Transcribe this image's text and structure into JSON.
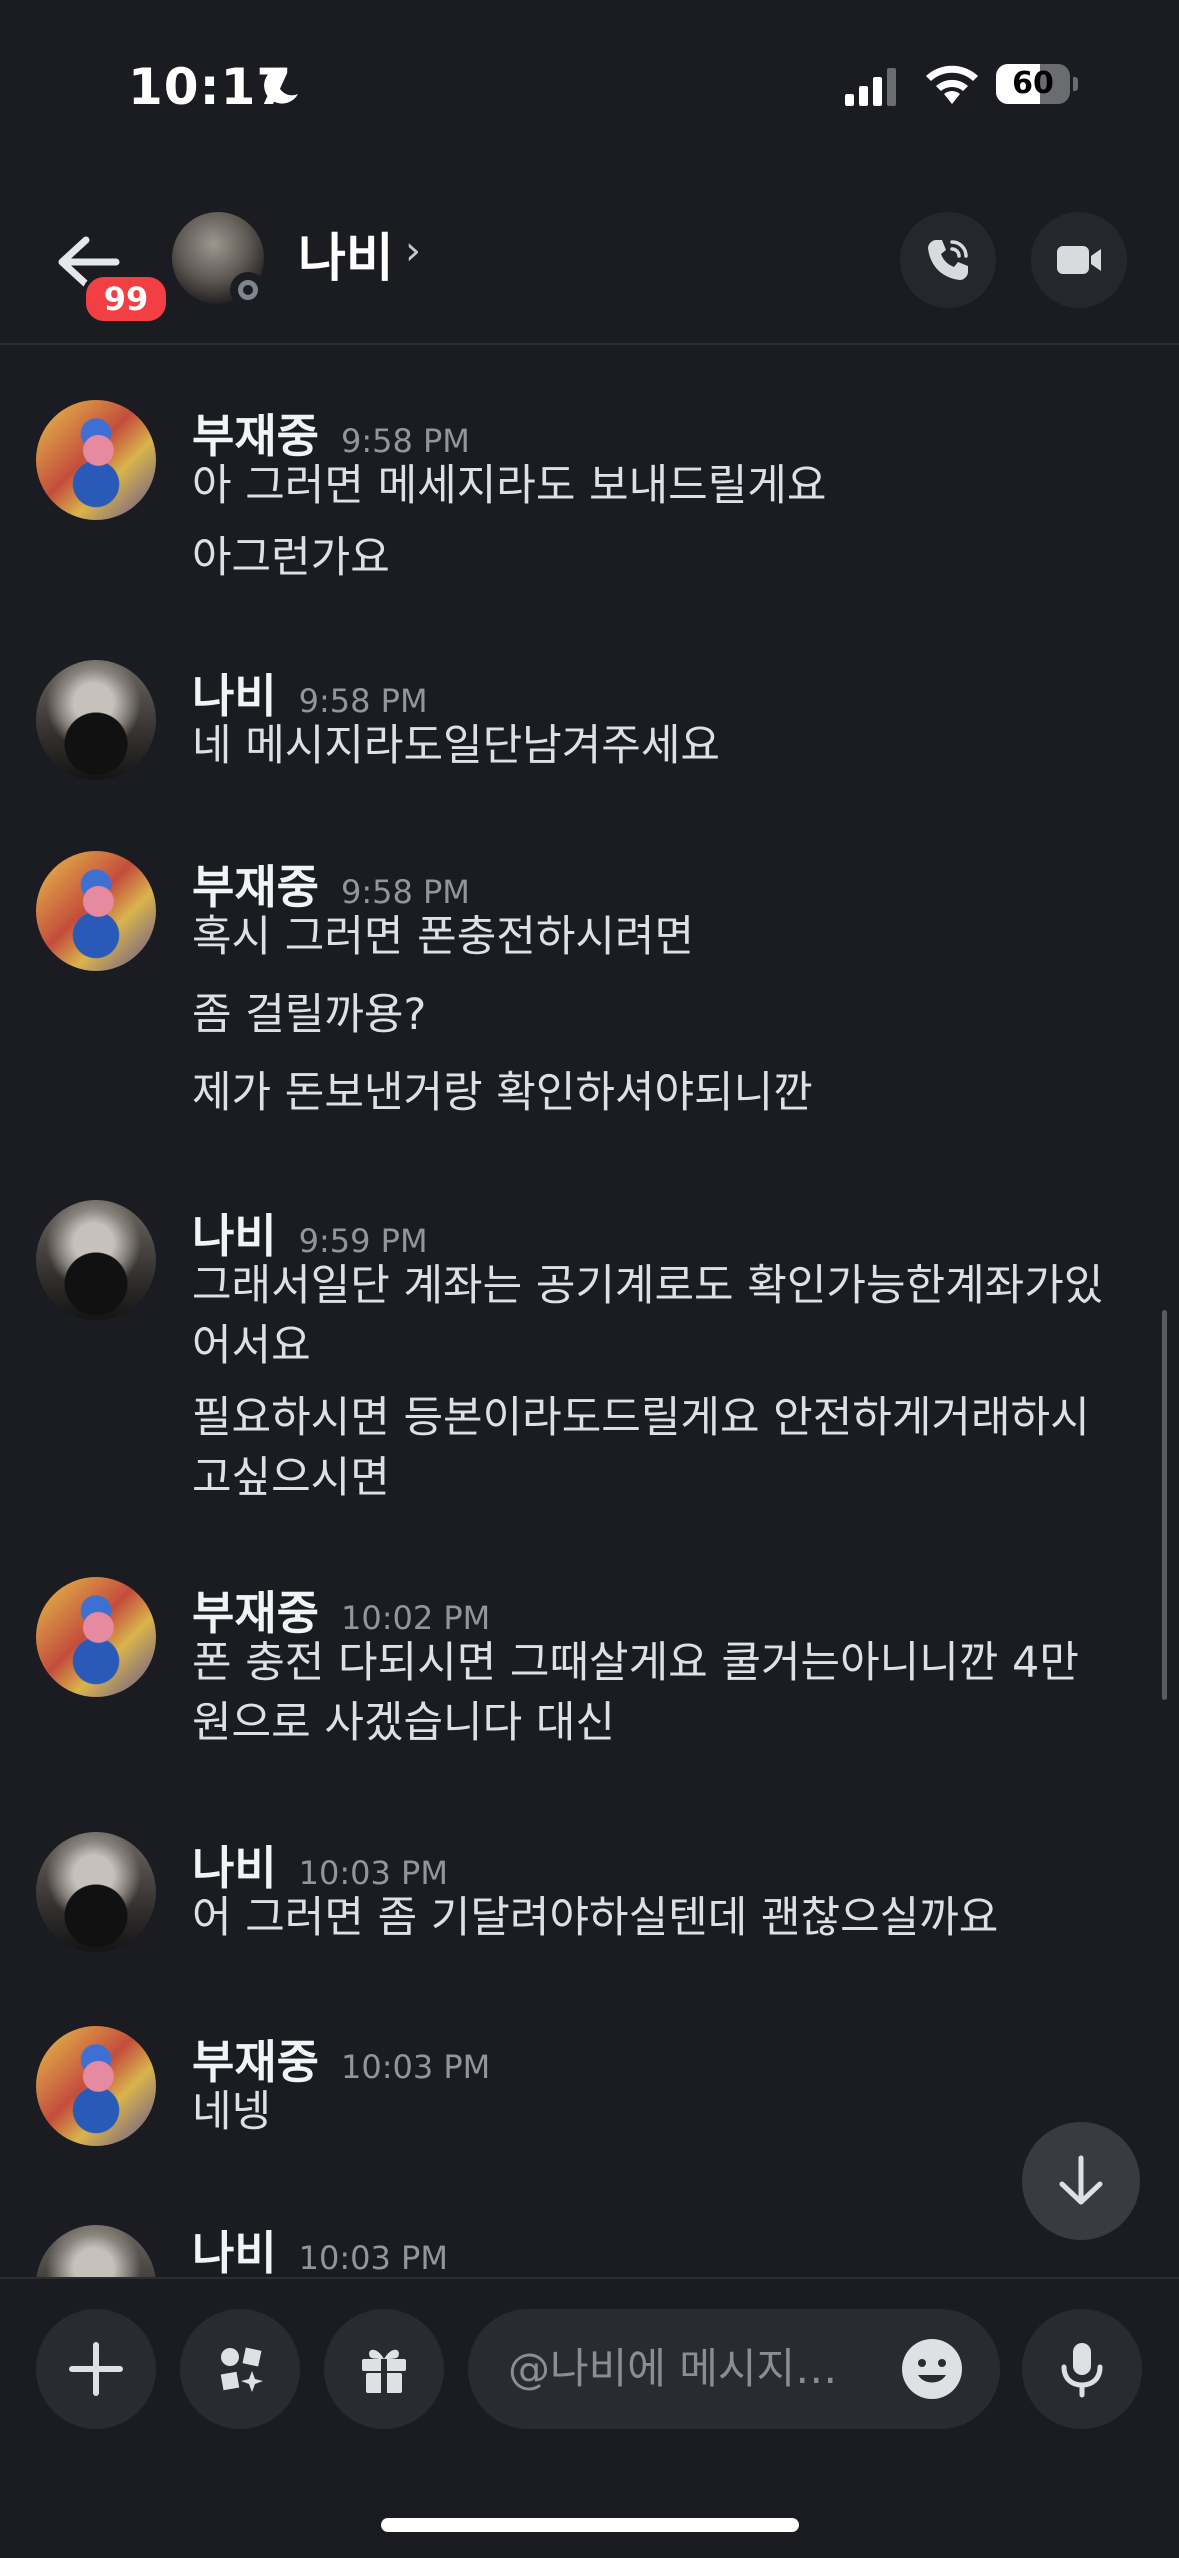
{
  "status_bar": {
    "time": "10:17",
    "battery_level": "60",
    "battery_fraction": 0.6
  },
  "header": {
    "back_badge": "99",
    "contact_name": "나비",
    "chevron": "›"
  },
  "messages": [
    {
      "author": "부재중",
      "time": "9:58 PM",
      "avatar": "avatar-bujaejung",
      "lines": [
        "아 그러면  메세지라도 보내드릴게요",
        "아그런가요"
      ]
    },
    {
      "author": "나비",
      "time": "9:58 PM",
      "avatar": "avatar-nabi",
      "lines": [
        "네 메시지라도일단남겨주세요"
      ]
    },
    {
      "author": "부재중",
      "time": "9:58 PM",
      "avatar": "avatar-bujaejung",
      "lines": [
        "혹시 그러면 폰충전하시려면",
        "좀 걸릴까용?",
        "제가 돈보낸거랑 확인하셔야되니깐"
      ]
    },
    {
      "author": "나비",
      "time": "9:59 PM",
      "avatar": "avatar-nabi",
      "lines": [
        "그래서일단 계좌는 공기계로도 확인가능한계좌가있",
        "어서요",
        "필요하시면 등본이라도드릴게요 안전하게거래하시",
        "고싶으시면"
      ]
    },
    {
      "author": "부재중",
      "time": "10:02 PM",
      "avatar": "avatar-bujaejung",
      "lines": [
        "폰 충전 다되시면 그때살게요 쿨거는아니니깐 4만",
        "원으로 사겠습니다 대신"
      ]
    },
    {
      "author": "나비",
      "time": "10:03 PM",
      "avatar": "avatar-nabi",
      "lines": [
        "어 그러면 좀 기달려야하실텐데 괜찮으실까요"
      ]
    },
    {
      "author": "부재중",
      "time": "10:03 PM",
      "avatar": "avatar-bujaejung",
      "lines": [
        "네넹"
      ]
    },
    {
      "author": "나비",
      "time": "10:03 PM",
      "avatar": "avatar-nabi",
      "lines": []
    }
  ],
  "composer": {
    "placeholder": "@나비에 메시지…"
  },
  "icons": {
    "back": "arrow-left-icon",
    "call": "phone-icon",
    "video": "video-camera-icon",
    "add": "plus-icon",
    "apps": "apps-icon",
    "gift": "gift-icon",
    "emoji": "emoji-icon",
    "mic": "microphone-icon",
    "jump": "arrow-down-icon"
  },
  "colors": {
    "background": "#1b1c22",
    "badge": "#f23f43",
    "button": "#2a2b31",
    "timestamp": "#94959c"
  }
}
